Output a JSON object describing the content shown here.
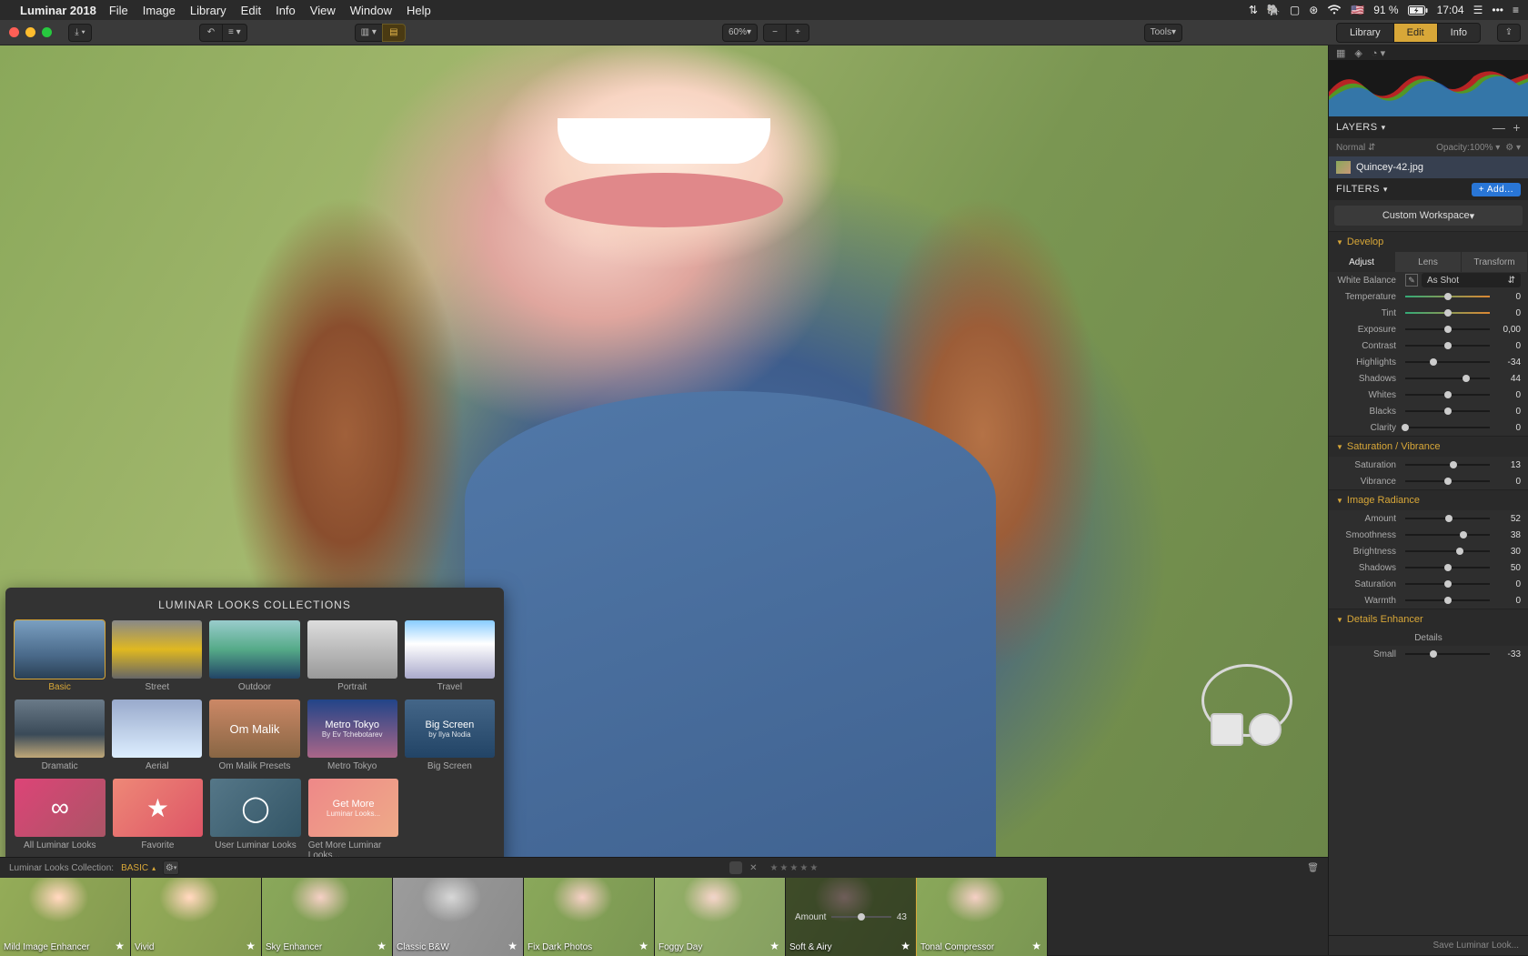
{
  "menubar": {
    "app": "Luminar 2018",
    "items": [
      "File",
      "Image",
      "Library",
      "Edit",
      "Info",
      "View",
      "Window",
      "Help"
    ],
    "battery": "91 %",
    "time": "17:04",
    "flag": "🇺🇸"
  },
  "toolbar": {
    "zoom": "60%",
    "tools": "Tools",
    "modes": {
      "library": "Library",
      "edit": "Edit",
      "info": "Info"
    }
  },
  "layers": {
    "title": "LAYERS",
    "blend": "Normal",
    "opacity_label": "Opacity:",
    "opacity": "100%",
    "row": "Quincey-42.jpg"
  },
  "filters": {
    "title": "FILTERS",
    "add": "+ Add...",
    "workspace": "Custom Workspace"
  },
  "develop": {
    "title": "Develop",
    "tabs": {
      "adjust": "Adjust",
      "lens": "Lens",
      "transform": "Transform"
    },
    "wb_label": "White Balance",
    "wb_value": "As Shot",
    "params": [
      {
        "label": "Temperature",
        "val": "0",
        "pos": 50,
        "grad": true
      },
      {
        "label": "Tint",
        "val": "0",
        "pos": 50,
        "grad": true
      },
      {
        "label": "Exposure",
        "val": "0,00",
        "pos": 50
      },
      {
        "label": "Contrast",
        "val": "0",
        "pos": 50
      },
      {
        "label": "Highlights",
        "val": "-34",
        "pos": 33
      },
      {
        "label": "Shadows",
        "val": "44",
        "pos": 72
      },
      {
        "label": "Whites",
        "val": "0",
        "pos": 50
      },
      {
        "label": "Blacks",
        "val": "0",
        "pos": 50
      },
      {
        "label": "Clarity",
        "val": "0",
        "pos": 0
      }
    ]
  },
  "satvib": {
    "title": "Saturation / Vibrance",
    "params": [
      {
        "label": "Saturation",
        "val": "13",
        "pos": 57
      },
      {
        "label": "Vibrance",
        "val": "0",
        "pos": 50
      }
    ]
  },
  "radiance": {
    "title": "Image Radiance",
    "params": [
      {
        "label": "Amount",
        "val": "52",
        "pos": 52
      },
      {
        "label": "Smoothness",
        "val": "38",
        "pos": 69
      },
      {
        "label": "Brightness",
        "val": "30",
        "pos": 65
      },
      {
        "label": "Shadows",
        "val": "50",
        "pos": 50
      },
      {
        "label": "Saturation",
        "val": "0",
        "pos": 50
      },
      {
        "label": "Warmth",
        "val": "0",
        "pos": 50
      }
    ]
  },
  "details": {
    "title": "Details Enhancer",
    "sub": "Details",
    "small_label": "Small",
    "small_val": "-33"
  },
  "save_look": "Save Luminar Look...",
  "looks_popup": {
    "title": "LUMINAR LOOKS COLLECTIONS",
    "row1": [
      {
        "label": "Basic",
        "cls": "basic",
        "selected": true
      },
      {
        "label": "Street",
        "cls": "street"
      },
      {
        "label": "Outdoor",
        "cls": "outdoor"
      },
      {
        "label": "Portrait",
        "cls": "portrait"
      },
      {
        "label": "Travel",
        "cls": "travel"
      }
    ],
    "row2": [
      {
        "label": "Dramatic",
        "cls": "dramatic"
      },
      {
        "label": "Aerial",
        "cls": "aerial"
      },
      {
        "label": "Om Malik Presets",
        "cls": "ommalik",
        "overlay": "Om Malik"
      },
      {
        "label": "Metro Tokyo",
        "cls": "metro",
        "overlay": "Metro Tokyo",
        "sub": "By Ev Tchebotarev"
      },
      {
        "label": "Big Screen",
        "cls": "bigscreen",
        "overlay": "Big Screen",
        "sub": "by Ilya Nodia"
      }
    ],
    "row3": [
      {
        "label": "All Luminar Looks",
        "cls": "all",
        "icon": "∞"
      },
      {
        "label": "Favorite",
        "cls": "fav",
        "icon": "★"
      },
      {
        "label": "User Luminar Looks",
        "cls": "user",
        "icon": "◯"
      },
      {
        "label": "Get More Luminar Looks...",
        "cls": "getmore",
        "overlay": "Get More",
        "sub": "Luminar Looks..."
      }
    ]
  },
  "filmbar": {
    "collection_label": "Luminar Looks Collection:",
    "collection_value": "BASIC",
    "amount_label": "Amount",
    "amount_value": "43",
    "items": [
      {
        "label": "Mild Image Enhancer",
        "cls": "warm",
        "star": true
      },
      {
        "label": "Vivid",
        "cls": "warm",
        "star": true
      },
      {
        "label": "Sky Enhancer",
        "cls": "",
        "star": true
      },
      {
        "label": "Classic B&W",
        "cls": "bw",
        "star": true
      },
      {
        "label": "Fix Dark Photos",
        "cls": "",
        "star": true
      },
      {
        "label": "Foggy Day",
        "cls": "fog",
        "star": true
      },
      {
        "label": "Soft & Airy",
        "cls": "",
        "star": true,
        "selected": true
      },
      {
        "label": "Tonal Compressor",
        "cls": "",
        "star": true
      }
    ]
  }
}
